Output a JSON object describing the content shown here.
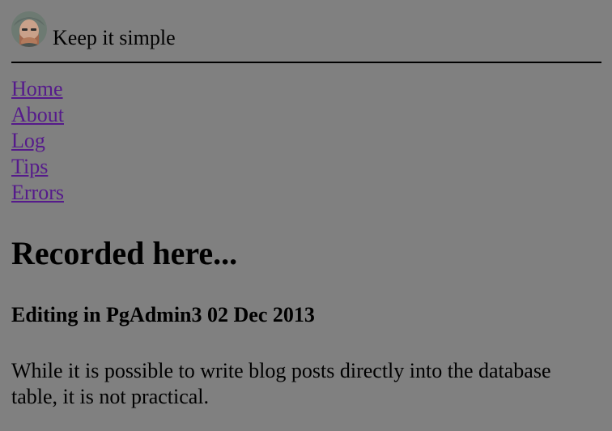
{
  "header": {
    "site_title": "Keep it simple",
    "avatar_icon": "user-avatar-icon"
  },
  "nav": {
    "items": [
      {
        "label": "Home"
      },
      {
        "label": "About"
      },
      {
        "label": "Log"
      },
      {
        "label": "Tips"
      },
      {
        "label": "Errors"
      }
    ],
    "link_color": "#551a8b"
  },
  "main": {
    "heading": "Recorded here...",
    "post": {
      "title": "Editing in PgAdmin3 02 Dec 2013",
      "body": "While it is possible to write blog posts directly into the database table, it is not practical."
    }
  },
  "colors": {
    "background": "#808080",
    "text": "#000000"
  }
}
